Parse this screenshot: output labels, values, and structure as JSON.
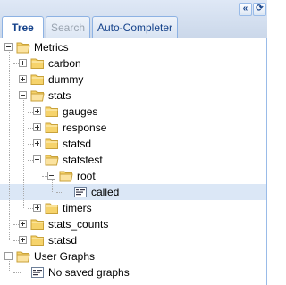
{
  "tabs": [
    {
      "label": "Tree",
      "state": "active"
    },
    {
      "label": "Search",
      "state": "disabled"
    },
    {
      "label": "Auto-Completer",
      "state": "normal"
    }
  ],
  "tools": [
    {
      "icon": "collapse-left-icon",
      "glyph": "«"
    },
    {
      "icon": "refresh-icon",
      "glyph": "⟳"
    }
  ],
  "tree": {
    "nodes": [
      {
        "label": "Metrics",
        "depth": 0,
        "type": "folder-open",
        "toggle": "minus"
      },
      {
        "label": "carbon",
        "depth": 1,
        "type": "folder",
        "toggle": "plus"
      },
      {
        "label": "dummy",
        "depth": 1,
        "type": "folder",
        "toggle": "plus"
      },
      {
        "label": "stats",
        "depth": 1,
        "type": "folder-open",
        "toggle": "minus"
      },
      {
        "label": "gauges",
        "depth": 2,
        "type": "folder",
        "toggle": "plus"
      },
      {
        "label": "response",
        "depth": 2,
        "type": "folder",
        "toggle": "plus"
      },
      {
        "label": "statsd",
        "depth": 2,
        "type": "folder",
        "toggle": "plus"
      },
      {
        "label": "statstest",
        "depth": 2,
        "type": "folder-open",
        "toggle": "minus"
      },
      {
        "label": "root",
        "depth": 3,
        "type": "folder-open",
        "toggle": "minus"
      },
      {
        "label": "called",
        "depth": 4,
        "type": "leaf",
        "toggle": "none",
        "selected": true
      },
      {
        "label": "timers",
        "depth": 2,
        "type": "folder",
        "toggle": "plus"
      },
      {
        "label": "stats_counts",
        "depth": 1,
        "type": "folder",
        "toggle": "plus"
      },
      {
        "label": "statsd",
        "depth": 1,
        "type": "folder",
        "toggle": "plus"
      },
      {
        "label": "User Graphs",
        "depth": 0,
        "type": "folder-open",
        "toggle": "minus"
      },
      {
        "label": "No saved graphs",
        "depth": 1,
        "type": "leaf",
        "toggle": "none"
      }
    ]
  },
  "colors": {
    "folder": "#f6d36b",
    "folder_edge": "#c9a23a",
    "selected_bg": "#dbe7f6",
    "tab_text": "#15428b"
  }
}
